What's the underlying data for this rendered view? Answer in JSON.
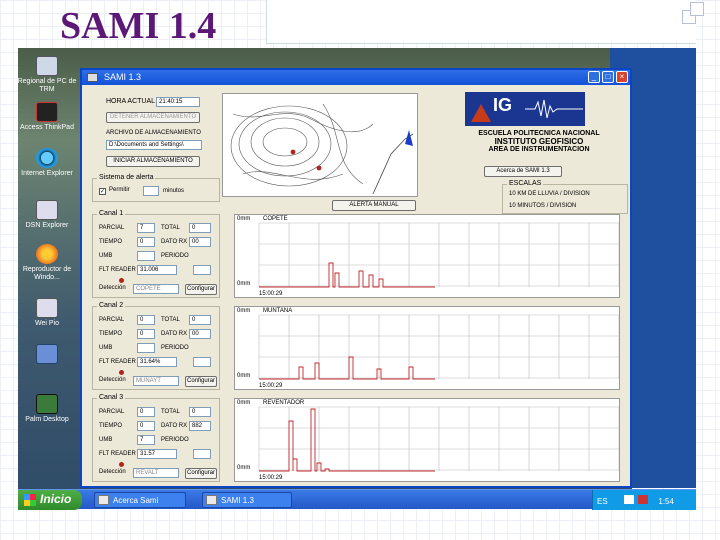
{
  "slide": {
    "title": "SAMI 1.4"
  },
  "desktop": {
    "icons": [
      {
        "label": "Regional de PC de TRM",
        "icon": "computer-icon"
      },
      {
        "label": "Access ThinkPad",
        "icon": "thinkpad-icon"
      },
      {
        "label": "Internet Explorer",
        "icon": "ie-icon"
      },
      {
        "label": "DSN Explorer",
        "icon": "shortcut-icon"
      },
      {
        "label": "Reproductor de Windo...",
        "icon": "media-player-icon"
      },
      {
        "label": "Wei Pio",
        "icon": "shortcut-icon"
      },
      {
        "label": "",
        "icon": "network-icon"
      },
      {
        "label": "Palm Desktop",
        "icon": "palm-icon"
      }
    ]
  },
  "taskbar": {
    "start_label": "Inicio",
    "buttons": [
      "Acerca Sami",
      "SAMI 1.3"
    ],
    "tray": {
      "lang": "ES",
      "time": "1:54"
    }
  },
  "window": {
    "title": "SAMI 1.3",
    "hora_label": "HORA ACTUAL",
    "hora_value": "21:40:15",
    "detener_btn": "DETENER ALMACENAMIENTO",
    "archivo_label": "ARCHIVO DE ALMACENAMIENTO",
    "archivo_value": "D:\\Documents and Settings\\",
    "iniciar_btn": "INICIAR ALMACENAMIENTO",
    "alerta_group": "Sistema de alerta",
    "alerta_check": "Permitir",
    "alerta_minutos": "minutos",
    "alerta_manual_btn": "ALERTA MANUAL",
    "logo_text": "IG",
    "institution": [
      "ESCUELA POLITECNICA NACIONAL",
      "INSTITUTO GEOFISICO",
      "AREA DE INSTRUMENTACION"
    ],
    "acerca_btn": "Acerca de SAMI 1.3",
    "escalas_title": "ESCALAS",
    "escalas": [
      "10 KM DE LLUVIA / DIVISION",
      "10 MINUTOS / DIVISION"
    ],
    "canales": [
      {
        "title": "Canal 1",
        "parcial": "7",
        "total": "0",
        "tiempo": "0",
        "dato_rx": "00",
        "umbral": "",
        "periodo": "",
        "flt_reader": "31.006",
        "periodo_val": "",
        "deteccion_label": "Detección",
        "deteccion_value": "COPETE",
        "configurar": "Configurar",
        "trace_name": "COPETE",
        "trace_top": "0mm",
        "trace_bottom": "0mm",
        "trace_time": "15:00:29"
      },
      {
        "title": "Canal 2",
        "parcial": "0",
        "total": "0",
        "tiempo": "0",
        "dato_rx": "00",
        "umbral": "",
        "periodo": "",
        "flt_reader": "31.64%",
        "periodo_val": "",
        "deteccion_label": "Detección",
        "deteccion_value": "MUNAYT",
        "configurar": "Configurar",
        "trace_name": "MUNTAÑA",
        "trace_top": "0mm",
        "trace_bottom": "0mm",
        "trace_time": "15:00:29"
      },
      {
        "title": "Canal 3",
        "parcial": "0",
        "total": "0",
        "tiempo": "0",
        "dato_rx": "882",
        "umbral": "7",
        "periodo": "",
        "flt_reader": "31.57",
        "periodo_val": "",
        "deteccion_label": "Detección",
        "deteccion_value": "REVALT",
        "configurar": "Configurar",
        "trace_name": "REVENTADOR",
        "trace_top": "0mm",
        "trace_bottom": "0mm",
        "trace_time": "15:00:29"
      }
    ],
    "field_labels": {
      "parcial": "PARCIAL",
      "total": "TOTAL",
      "tiempo": "TIEMPO",
      "dato_rx": "DATO RX",
      "umbral": "UMB",
      "periodo": "PERIODO",
      "flt_reader": "FLT READER"
    }
  },
  "colors": {
    "title": "#5b1877",
    "window_border": "#0a46c4",
    "trace_spike": "#c0272d",
    "logo_bg": "#1a3690"
  }
}
